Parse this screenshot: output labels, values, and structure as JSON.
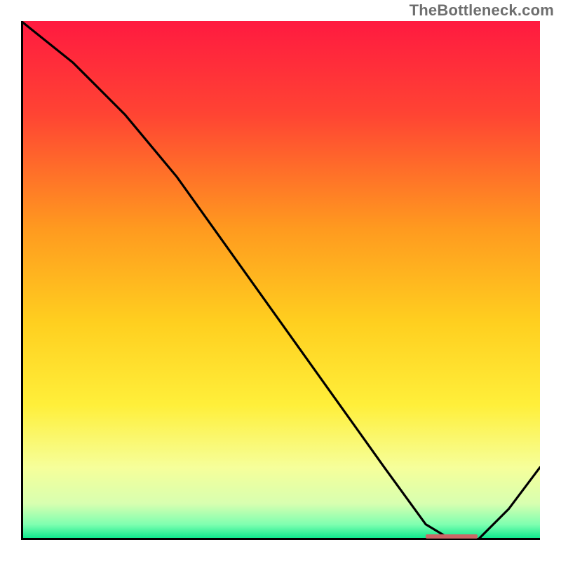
{
  "watermark": "TheBottleneck.com",
  "chart_data": {
    "type": "line",
    "title": "",
    "xlabel": "",
    "ylabel": "",
    "xlim": [
      0,
      1
    ],
    "ylim": [
      0,
      100
    ],
    "x": [
      0.0,
      0.1,
      0.2,
      0.3,
      0.4,
      0.5,
      0.6,
      0.7,
      0.78,
      0.83,
      0.88,
      0.94,
      1.0
    ],
    "values": [
      100,
      92,
      82,
      70,
      56,
      42,
      28,
      14,
      3,
      0,
      0,
      6,
      14
    ],
    "optimal_range": [
      0.78,
      0.88
    ],
    "gradient_stops": [
      {
        "offset": 0.0,
        "color": "#ff1a40"
      },
      {
        "offset": 0.18,
        "color": "#ff4433"
      },
      {
        "offset": 0.4,
        "color": "#ff9a1f"
      },
      {
        "offset": 0.58,
        "color": "#ffcf1f"
      },
      {
        "offset": 0.74,
        "color": "#ffef3a"
      },
      {
        "offset": 0.86,
        "color": "#f6ff9a"
      },
      {
        "offset": 0.93,
        "color": "#d8ffb0"
      },
      {
        "offset": 0.97,
        "color": "#7fffb0"
      },
      {
        "offset": 1.0,
        "color": "#00e68a"
      }
    ]
  }
}
